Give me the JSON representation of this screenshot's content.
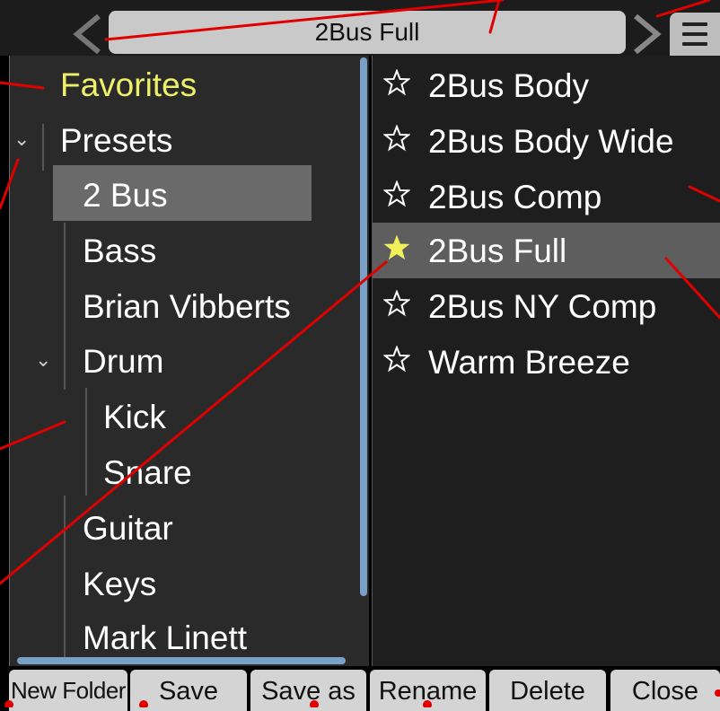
{
  "header": {
    "title": "2Bus Full"
  },
  "tree": {
    "favorites": "Favorites",
    "presets": "Presets",
    "items": [
      "2 Bus",
      "Bass",
      "Brian Vibberts",
      "Drum",
      "Kick",
      "Snare",
      "Guitar",
      "Keys",
      "Mark Linett"
    ]
  },
  "presets": [
    {
      "label": "2Bus Body",
      "favorite": false
    },
    {
      "label": "2Bus Body Wide",
      "favorite": false
    },
    {
      "label": "2Bus Comp",
      "favorite": false
    },
    {
      "label": "2Bus Full",
      "favorite": true
    },
    {
      "label": "2Bus NY Comp",
      "favorite": false
    },
    {
      "label": "Warm Breeze",
      "favorite": false
    }
  ],
  "buttons": {
    "new_folder": "New Folder",
    "save": "Save",
    "save_as": "Save as",
    "rename": "Rename",
    "delete": "Delete",
    "close": "Close"
  },
  "colors": {
    "favorite_text": "#eef06a",
    "favorite_star": "#f2f05a",
    "selection": "#6a6a6a",
    "scrollbar": "#7aa0c8",
    "annotation": "#e00000"
  }
}
